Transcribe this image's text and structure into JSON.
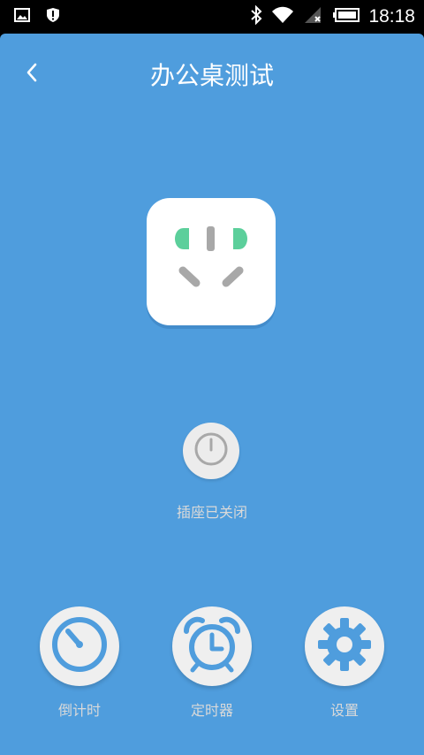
{
  "status_bar": {
    "time": "18:18",
    "icons": [
      "image-icon",
      "shield-alert-icon",
      "bluetooth-icon",
      "wifi-icon",
      "cellular-no-signal-icon",
      "battery-icon"
    ]
  },
  "header": {
    "title": "办公桌测试",
    "back_icon": "chevron-left-icon"
  },
  "device": {
    "icon": "power-socket-icon",
    "status_text": "插座已关闭"
  },
  "actions": {
    "countdown": {
      "label": "倒计时",
      "icon": "countdown-icon"
    },
    "timer": {
      "label": "定时器",
      "icon": "alarm-clock-icon"
    },
    "settings": {
      "label": "设置",
      "icon": "gear-icon"
    }
  },
  "colors": {
    "background": "#4f9ddd",
    "accent_green": "#5ccf9b",
    "icon_blue": "#4f9ddd",
    "label_gray": "#d9d9d9"
  }
}
